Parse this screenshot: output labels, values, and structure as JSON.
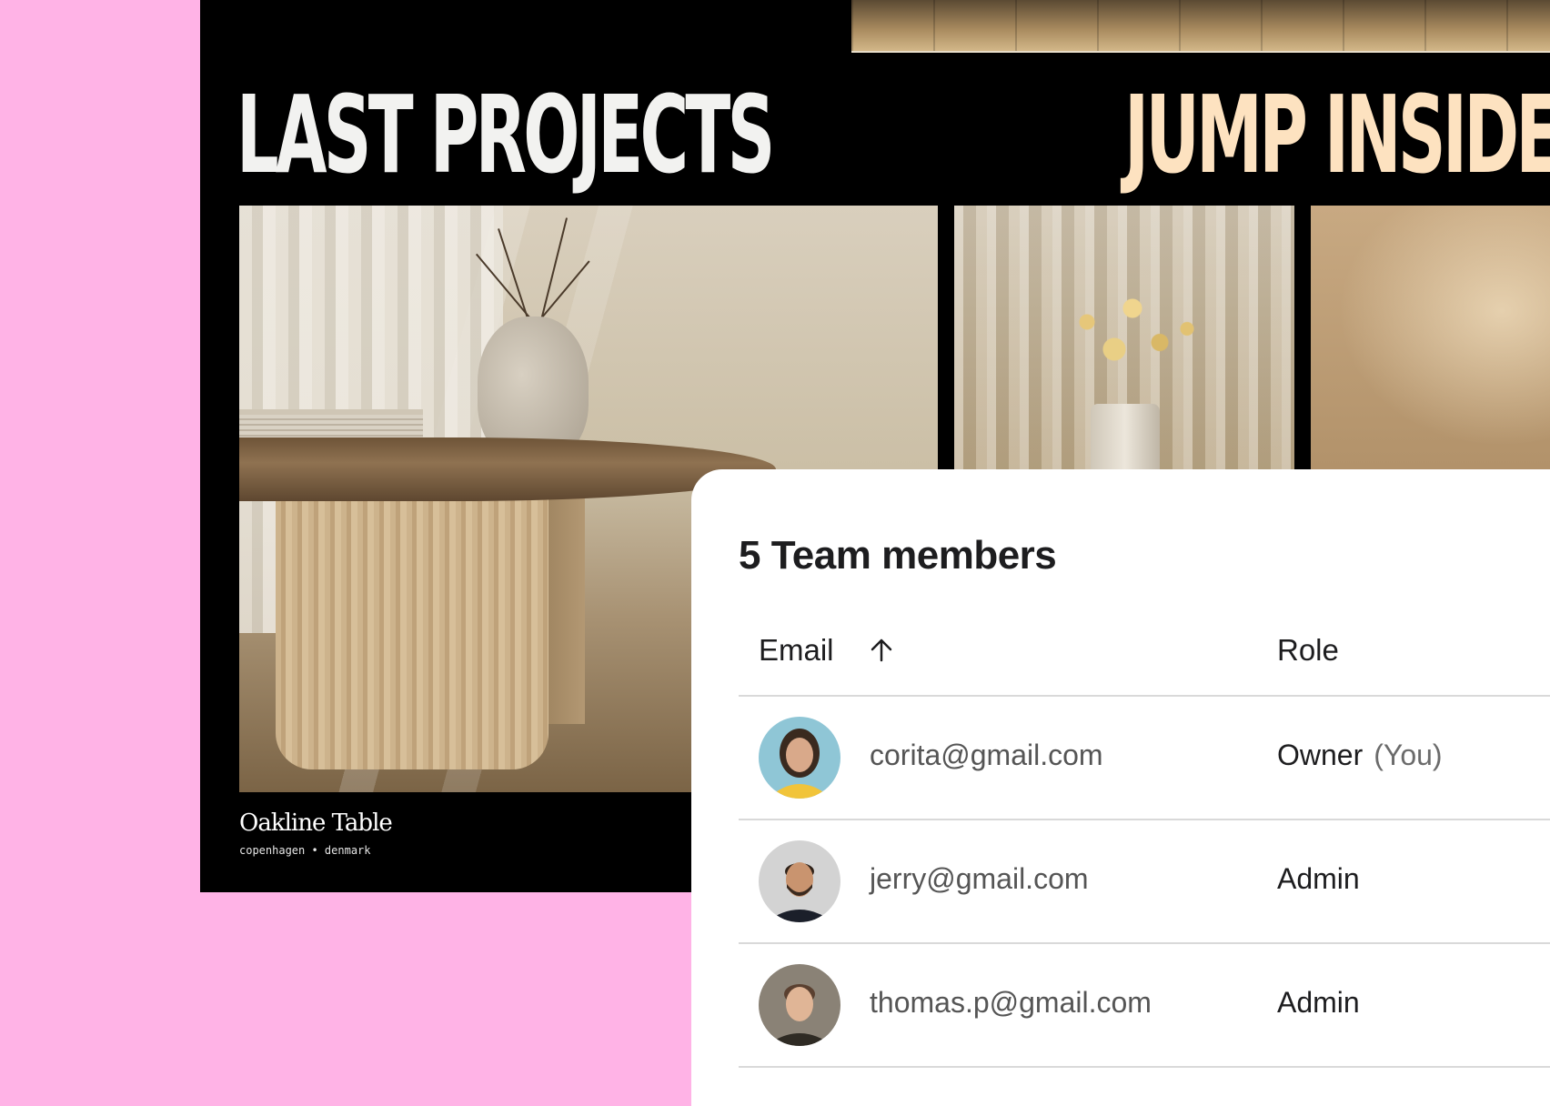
{
  "site": {
    "headline_left": "LAST PROJECTS",
    "headline_right": "JUMP INSIDE",
    "project": {
      "title": "Oakline Table",
      "location": "copenhagen • denmark"
    }
  },
  "team": {
    "title": "5 Team members",
    "columns": {
      "email": "Email",
      "role": "Role"
    },
    "sort_icon": "arrow-up-icon",
    "members": [
      {
        "email": "corita@gmail.com",
        "role": "Owner",
        "note": "(You)"
      },
      {
        "email": "jerry@gmail.com",
        "role": "Admin"
      },
      {
        "email": "thomas.p@gmail.com",
        "role": "Admin"
      }
    ]
  },
  "colors": {
    "background": "#ffb3e6",
    "site_bg": "#000000",
    "headline_left": "#f2f2f0",
    "headline_right": "#fde2c0"
  }
}
